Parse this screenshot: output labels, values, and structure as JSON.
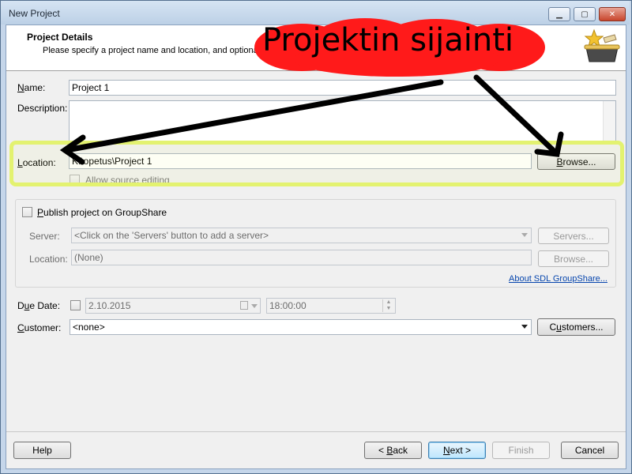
{
  "window": {
    "title": "New Project",
    "controls": {
      "minimize": "▁",
      "maximize": "▢",
      "close": "✕"
    }
  },
  "header": {
    "title": "Project Details",
    "subtitle": "Please specify a project name and location, and optionally"
  },
  "form": {
    "name_label": "Name:",
    "name_value": "Project 1",
    "description_label": "Description:",
    "description_value": "",
    "location_label": "Location:",
    "location_value": "K:\\opetus\\Project 1",
    "browse_label": "Browse...",
    "allow_source_editing_label": "Allow source editing",
    "groupshare": {
      "publish_label": "Publish project on GroupShare",
      "server_label": "Server:",
      "server_value": "<Click on the 'Servers' button to add a server>",
      "servers_button": "Servers...",
      "location_label": "Location:",
      "location_value": "(None)",
      "browse_button": "Browse...",
      "about_link": "About SDL GroupShare..."
    },
    "due_date_label": "Due Date:",
    "due_date_value": "2.10.2015",
    "due_time_value": "18:00:00",
    "customer_label": "Customer:",
    "customer_value": "<none>",
    "customers_button": "Customers..."
  },
  "footer": {
    "help": "Help",
    "back": "< Back",
    "next": "Next >",
    "finish": "Finish",
    "cancel": "Cancel"
  },
  "annotation": {
    "text": "Projektin sijainti",
    "highlight_color": "#e3f270",
    "cloud_color": "#ff1a1a"
  },
  "icons": {
    "header_icon": "star-basket-icon",
    "calendar": "calendar-icon",
    "spinner": "spinner-icon"
  }
}
